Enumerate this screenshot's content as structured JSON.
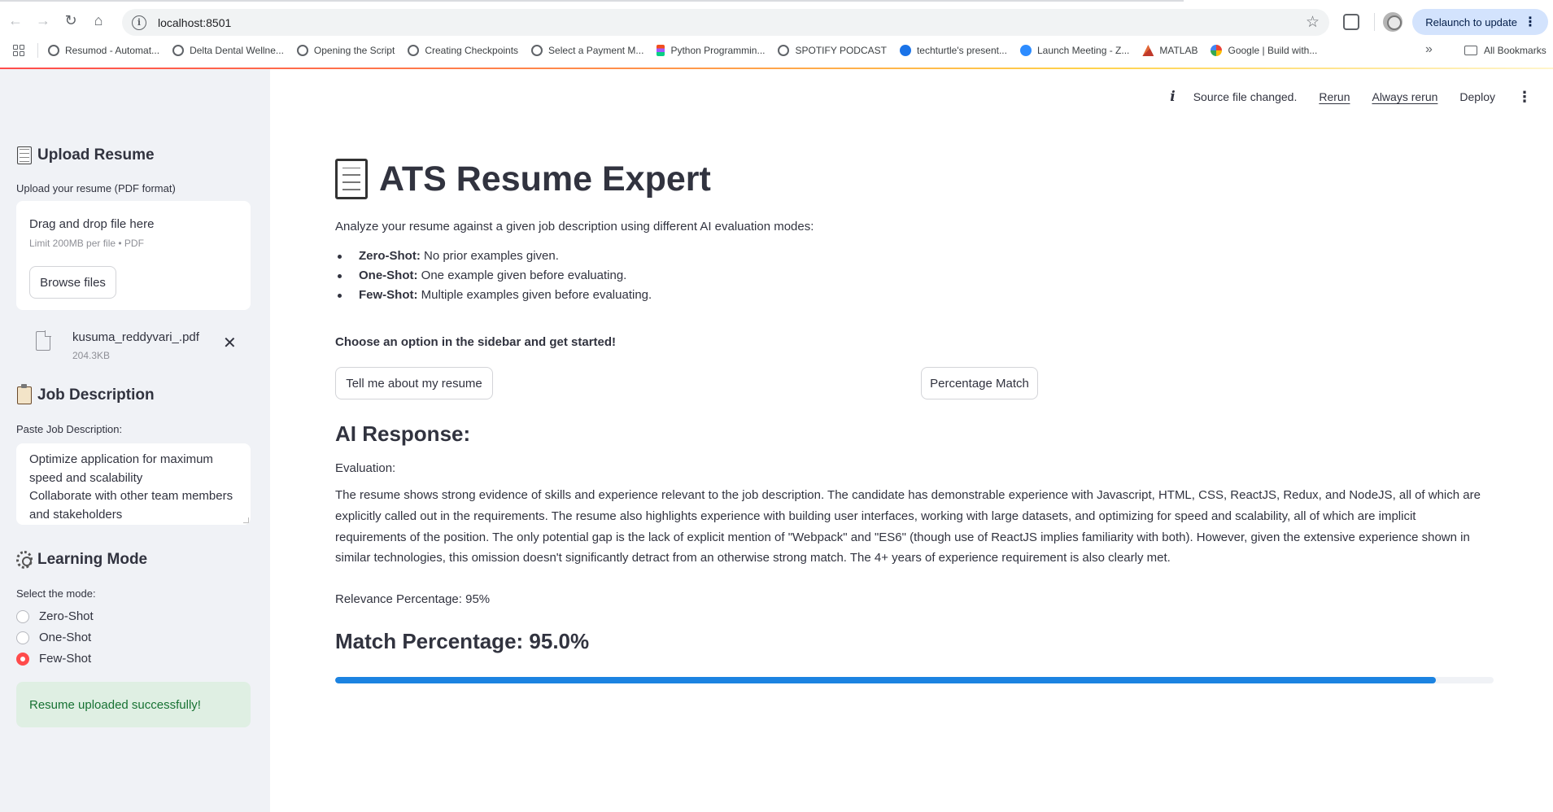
{
  "browser": {
    "url": "localhost:8501",
    "relaunch_label": "Relaunch to update",
    "bookmarks": [
      "Resumod - Automat...",
      "Delta Dental Wellne...",
      "Opening the Script",
      "Creating Checkpoints",
      "Select a Payment M...",
      "Python Programmin...",
      "SPOTIFY PODCAST",
      "techturtle's present...",
      "Launch Meeting - Z...",
      "MATLAB",
      "Google | Build with..."
    ],
    "all_bookmarks": "All Bookmarks"
  },
  "header": {
    "status": "Source file changed.",
    "rerun": "Rerun",
    "always_rerun": "Always rerun",
    "deploy": "Deploy"
  },
  "sidebar": {
    "upload_title": "Upload Resume",
    "upload_label": "Upload your resume (PDF format)",
    "dropzone_title": "Drag and drop file here",
    "dropzone_limit": "Limit 200MB per file • PDF",
    "browse_label": "Browse files",
    "file_name": "kusuma_reddyvari_.pdf",
    "file_size": "204.3KB",
    "jd_title": "Job Description",
    "jd_label": "Paste Job Description:",
    "jd_text": "Optimize application for maximum speed and scalability\nCollaborate with other team members and stakeholders",
    "mode_title": "Learning Mode",
    "mode_label": "Select the mode:",
    "modes": [
      "Zero-Shot",
      "One-Shot",
      "Few-Shot"
    ],
    "selected_mode": "Few-Shot",
    "success_msg": "Resume uploaded successfully!"
  },
  "main": {
    "title": "ATS Resume Expert",
    "intro": "Analyze your resume against a given job description using different AI evaluation modes:",
    "bullets": [
      {
        "term": "Zero-Shot:",
        "desc": "No prior examples given."
      },
      {
        "term": "One-Shot:",
        "desc": "One example given before evaluating."
      },
      {
        "term": "Few-Shot:",
        "desc": "Multiple examples given before evaluating."
      }
    ],
    "choose": "Choose an option in the sidebar and get started!",
    "btn_tell": "Tell me about my resume",
    "btn_match": "Percentage Match",
    "ai_heading": "AI Response:",
    "evaluation_label": "Evaluation:",
    "evaluation_text": "The resume shows strong evidence of skills and experience relevant to the job description. The candidate has demonstrable experience with Javascript, HTML, CSS, ReactJS, Redux, and NodeJS, all of which are explicitly called out in the requirements. The resume also highlights experience with building user interfaces, working with large datasets, and optimizing for speed and scalability, all of which are implicit requirements of the position. The only potential gap is the lack of explicit mention of \"Webpack\" and \"ES6\" (though use of ReactJS implies familiarity with both). However, given the extensive experience shown in similar technologies, this omission doesn't significantly detract from an otherwise strong match. The 4+ years of experience requirement is also clearly met.",
    "relevance": "Relevance Percentage: 95%",
    "match_heading": "Match Percentage: 95.0%",
    "match_value": 95.0
  },
  "colors": {
    "accent": "#ff4b4b",
    "progress": "#1c83e1",
    "success_bg": "#dfefe3",
    "success_text": "#177233",
    "sidebar_bg": "#f0f2f6"
  }
}
